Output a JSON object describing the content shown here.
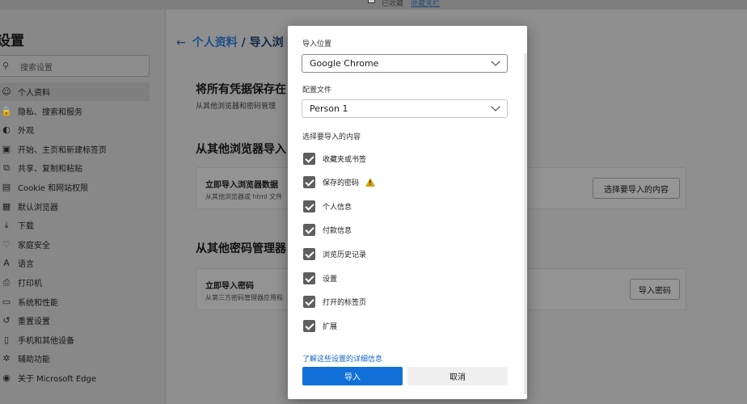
{
  "topbar": {
    "text": "已收藏",
    "link": "收藏夹栏"
  },
  "sidebar": {
    "title": "设置",
    "search_placeholder": "搜索设置",
    "items": [
      {
        "icon": "person-icon",
        "glyph": "☺",
        "label": "个人资料"
      },
      {
        "icon": "lock-icon",
        "glyph": "🔒",
        "label": "隐私、搜索和服务"
      },
      {
        "icon": "appearance-icon",
        "glyph": "◐",
        "label": "外观"
      },
      {
        "icon": "start-page-icon",
        "glyph": "▣",
        "label": "开始、主页和新建标签页"
      },
      {
        "icon": "share-icon",
        "glyph": "⧉",
        "label": "共享、复制和粘贴"
      },
      {
        "icon": "cookie-icon",
        "glyph": "▤",
        "label": "Cookie 和网站权限"
      },
      {
        "icon": "default-browser-icon",
        "glyph": "▦",
        "label": "默认浏览器"
      },
      {
        "icon": "download-icon",
        "glyph": "⤓",
        "label": "下载"
      },
      {
        "icon": "family-icon",
        "glyph": "♡",
        "label": "家庭安全"
      },
      {
        "icon": "language-icon",
        "glyph": "A",
        "label": "语言"
      },
      {
        "icon": "printer-icon",
        "glyph": "⎙",
        "label": "打印机"
      },
      {
        "icon": "system-icon",
        "glyph": "▭",
        "label": "系统和性能"
      },
      {
        "icon": "reset-icon",
        "glyph": "↺",
        "label": "重置设置"
      },
      {
        "icon": "phone-icon",
        "glyph": "▯",
        "label": "手机和其他设备"
      },
      {
        "icon": "accessibility-icon",
        "glyph": "✲",
        "label": "辅助功能"
      },
      {
        "icon": "edge-logo-icon",
        "glyph": "◉",
        "label": "关于 Microsoft Edge"
      }
    ]
  },
  "main": {
    "breadcrumb_link": "个人资料",
    "breadcrumb_sep": " / ",
    "breadcrumb_current": "导入浏",
    "section1_title": "将所有凭据保存在",
    "section1_sub": "从其他浏览器和密码管理",
    "section2_title": "从其他浏览器导入",
    "card1_title": "立即导入浏览器数据",
    "card1_desc": "从其他浏览器或 html 文件",
    "card1_button": "选择要导入的内容",
    "section3_title": "从其他密码管理器",
    "card2_title": "立即导入密码",
    "card2_desc": "从第三方密码管理器应用程",
    "card2_button": "导入密码"
  },
  "dialog": {
    "source_label": "导入位置",
    "source_value": "Google Chrome",
    "profile_label": "配置文件",
    "profile_value": "Person 1",
    "choose_label": "选择要导入的内容",
    "options": [
      {
        "label": "收藏夹或书签",
        "checked": true,
        "warning": false
      },
      {
        "label": "保存的密码",
        "checked": true,
        "warning": true
      },
      {
        "label": "个人信息",
        "checked": true,
        "warning": false
      },
      {
        "label": "付款信息",
        "checked": true,
        "warning": false
      },
      {
        "label": "浏览历史记录",
        "checked": true,
        "warning": false
      },
      {
        "label": "设置",
        "checked": true,
        "warning": false
      },
      {
        "label": "打开的标签页",
        "checked": true,
        "warning": false
      },
      {
        "label": "扩展",
        "checked": true,
        "warning": false
      }
    ],
    "details_link": "了解这些设置的详细信息",
    "import_button": "导入",
    "cancel_button": "取消"
  },
  "colors": {
    "primary": "#1070d8",
    "link": "#1066c4",
    "warning": "#d8a600",
    "checkbox": "#5e5e5e",
    "overlay": "#8f8f8f"
  }
}
